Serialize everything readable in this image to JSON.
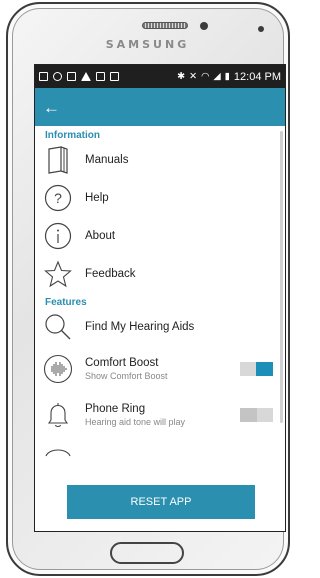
{
  "device": {
    "brand": "SAMSUNG"
  },
  "statusbar": {
    "time": "12:04 PM",
    "icons": [
      "message-icon",
      "link-icon",
      "image-icon",
      "warning-icon",
      "lock-icon",
      "lock-icon",
      "bluetooth-icon",
      "mute-icon",
      "wifi-icon",
      "signal-icon",
      "battery-icon"
    ]
  },
  "appbar": {
    "back_icon": "arrow-left-icon",
    "back_glyph": "←"
  },
  "sections": {
    "information": {
      "title": "Information",
      "items": [
        {
          "label": "Manuals",
          "icon": "book-icon"
        },
        {
          "label": "Help",
          "icon": "question-icon"
        },
        {
          "label": "About",
          "icon": "info-icon"
        },
        {
          "label": "Feedback",
          "icon": "star-icon"
        }
      ]
    },
    "features": {
      "title": "Features",
      "find": {
        "label": "Find My Hearing Aids",
        "icon": "search-icon"
      },
      "comfort_boost": {
        "label": "Comfort Boost",
        "sub": "Show Comfort Boost",
        "icon": "soundwave-icon",
        "enabled": true
      },
      "phone_ring": {
        "label": "Phone Ring",
        "sub": "Hearing aid tone will play",
        "icon": "bell-icon",
        "enabled": false
      }
    }
  },
  "reset_button": {
    "label": "RESET APP"
  },
  "colors": {
    "accent": "#2b8fb0",
    "toggle_on": "#1b8fb7",
    "statusbar": "#1f1f1f"
  }
}
